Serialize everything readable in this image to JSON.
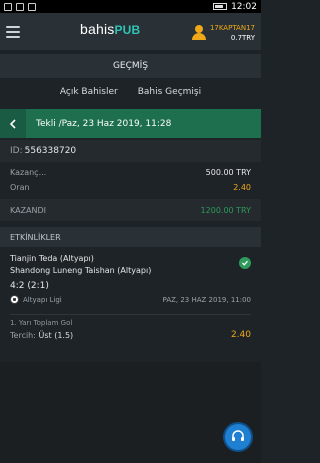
{
  "status_bar": {
    "time": "12:02"
  },
  "header": {
    "logo_text": "bahis",
    "logo_accent": "PUB",
    "username": "17KAPTAN17",
    "balance": "0.7TRY"
  },
  "page_title": "GEÇMİŞ",
  "tabs": [
    {
      "label": "Açık Bahisler"
    },
    {
      "label": "Bahis Geçmişi"
    }
  ],
  "coupon": {
    "title": "Tekli /Paz, 23 Haz 2019, 11:28",
    "id_label": "ID:",
    "id_value": "556338720",
    "win_label": "Kazanç...",
    "win_value": "500.00 TRY",
    "odds_label": "Oran",
    "odds_value": "2.40",
    "result_label": "KAZANDI",
    "result_value": "1200.00 TRY"
  },
  "events_header": "ETKİNLİKLER",
  "event": {
    "home": "Tianjin Teda (Altyapı)",
    "away": "Shandong Luneng Taishan (Altyapı)",
    "score": "4:2 (2:1)",
    "league": "Altyapı Ligi",
    "date": "PAZ, 23 HAZ 2019, 11:00",
    "market": "1. Yarı Toplam Gol",
    "pick_label": "Tercih:",
    "pick_value": "Üst (1.5)",
    "odd": "2.40"
  },
  "colors": {
    "accent_green": "#1d6f4e",
    "gold": "#f0a818",
    "win_green": "#2e9b5c",
    "support_blue": "#1f7fd0"
  }
}
